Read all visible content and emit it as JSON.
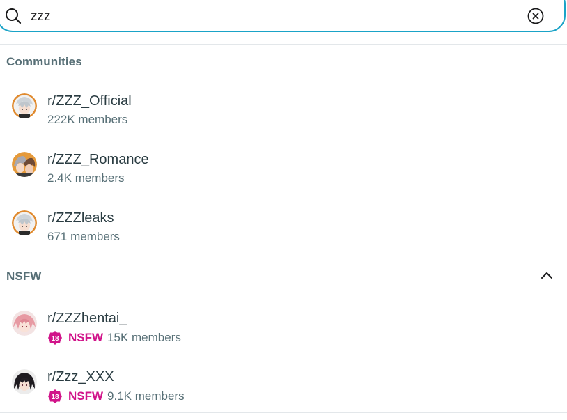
{
  "search": {
    "query": "zzz",
    "icon": "search-icon",
    "clear_icon": "clear-icon"
  },
  "sections": {
    "communities": {
      "title": "Communities",
      "items": [
        {
          "name": "r/ZZZ_Official",
          "members": "222K members",
          "avatar": "avatar-anime-silver-hair"
        },
        {
          "name": "r/ZZZ_Romance",
          "members": "2.4K members",
          "avatar": "avatar-anime-couple"
        },
        {
          "name": "r/ZZZleaks",
          "members": "671 members",
          "avatar": "avatar-anime-silver-hair"
        }
      ]
    },
    "nsfw": {
      "title": "NSFW",
      "collapse_icon": "chevron-up-icon",
      "badge_number": "18",
      "badge_label": "NSFW",
      "items": [
        {
          "name": "r/ZZZhentai_",
          "members": "15K members",
          "avatar": "avatar-anime-pink-hair"
        },
        {
          "name": "r/Zzz_XXX",
          "members": "9.1K members",
          "avatar": "avatar-anime-dark-hair"
        }
      ]
    }
  },
  "colors": {
    "accent": "#1aa3c7",
    "nsfw": "#d1148a",
    "muted_text": "#576f76",
    "primary_text": "#2a3c42"
  }
}
